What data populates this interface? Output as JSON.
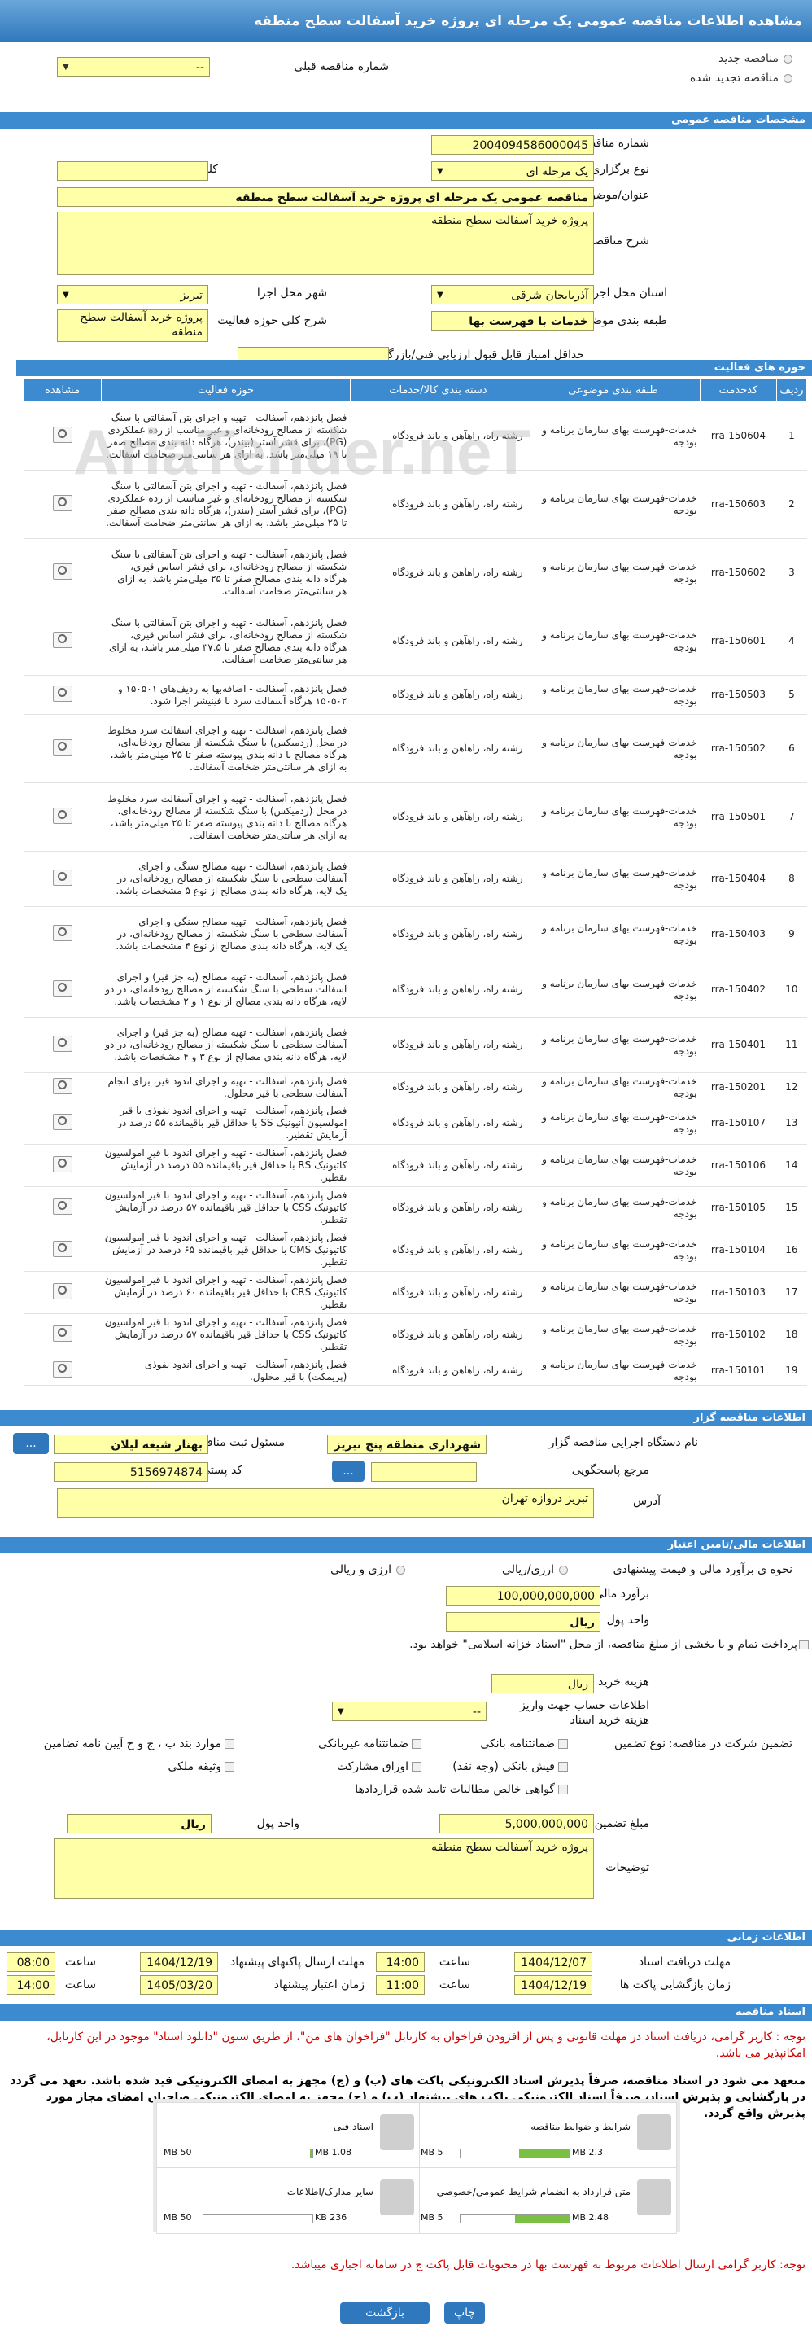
{
  "title": "مشاهده اطلاعات مناقصه عمومی یک مرحله ای پروژه خرید آسفالت سطح منطقه",
  "radios": {
    "new": "مناقصه جدید",
    "renewed": "مناقصه تجدید شده",
    "prev_label": "شماره مناقصه قبلی",
    "prev_value": "--"
  },
  "sections": {
    "specs": "مشخصات مناقصه عمومی",
    "activities": "حوزه های فعالیت",
    "organizer": "اطلاعات مناقصه گزار",
    "financial": "اطلاعات مالی/تامین اعتبار",
    "timing": "اطلاعات زمانی",
    "docs": "اسناد مناقصه"
  },
  "specs": {
    "number_label": "شماره مناقصه",
    "number": "2004094586000045",
    "type_label": "نوع برگزاری",
    "type": "یک مرحله ای",
    "keyword_label": "کلید واژه",
    "keyword": "",
    "subject_label": "عنوان/موضوع مناقصه",
    "subject": "مناقصه عمومی یک مرحله ای پروژه خرید آسفالت سطح منطقه",
    "desc_label": "شرح مناقصه",
    "desc": "پروژه خرید آسفالت سطح منطقه",
    "province_label": "استان محل اجرا",
    "province": "آذربایجان شرقی",
    "city_label": "شهر محل اجرا",
    "city": "تبریز",
    "category_label": "طبقه بندی موضوعی",
    "category": "خدمات با فهرست بها",
    "scope_label": "شرح کلی حوزه فعالیت",
    "scope": "پروژه خرید آسفالت سطح منطقه",
    "min_score_label": "حداقل امتیاز قابل قبول ارزیابی فنی/بازرگانی",
    "min_score": ""
  },
  "activity_table": {
    "headers": [
      "ردیف",
      "کدخدمت",
      "طبقه بندی موضوعی",
      "دسته بندی کالا/خدمات",
      "حوزه فعالیت",
      "مشاهده"
    ],
    "rows": [
      {
        "idx": "1",
        "code": "rra-150604",
        "cls": "خدمات-فهرست بهای سازمان برنامه و بودجه",
        "cat": "رشته راه، راهآهن و باند فرودگاه",
        "scope": "فصل پانزدهم، آسفالت - تهیه و اجرای بتن آسفالتی با سنگ شکسته از مصالح رودخانه‌ای و غیر مناسب از رده عملکردی (PG)، برای قشر آستر (بیندر)، هرگاه دانه بندی مصالح صفر تا ۱۹ میلی‌متر باشد، به ازای هر سانتی‌متر ضخامت آسفالت."
      },
      {
        "idx": "2",
        "code": "rra-150603",
        "cls": "خدمات-فهرست بهای سازمان برنامه و بودجه",
        "cat": "رشته راه، راهآهن و باند فرودگاه",
        "scope": "فصل پانزدهم، آسفالت - تهیه و اجرای بتن آسفالتی با سنگ شکسته از مصالح رودخانه‌ای و غیر مناسب از رده عملکردی (PG)، برای قشر آستر (بیندر)، هرگاه دانه بندی مصالح صفر تا ۲۵ میلی‌متر باشد، به ازای هر سانتی‌متر ضخامت آسفالت."
      },
      {
        "idx": "3",
        "code": "rra-150602",
        "cls": "خدمات-فهرست بهای سازمان برنامه و بودجه",
        "cat": "رشته راه، راهآهن و باند فرودگاه",
        "scope": "فصل پانزدهم، آسفالت - تهیه و اجرای بتن آسفالتی با سنگ شکسته از مصالح رودخانه‌ای، برای قشر اساس قیری، هرگاه دانه بندی مصالح صفر تا ۲۵ میلی‌متر باشد، به ازای هر سانتی‌متر ضخامت آسفالت."
      },
      {
        "idx": "4",
        "code": "rra-150601",
        "cls": "خدمات-فهرست بهای سازمان برنامه و بودجه",
        "cat": "رشته راه، راهآهن و باند فرودگاه",
        "scope": "فصل پانزدهم، آسفالت - تهیه و اجرای بتن آسفالتی با سنگ شکسته از مصالح رودخانه‌ای، برای قشر اساس قیری، هرگاه دانه بندی مصالح صفر تا ۳۷.۵ میلی‌متر باشد، به ازای هر سانتی‌متر ضخامت آسفالت."
      },
      {
        "idx": "5",
        "code": "rra-150503",
        "cls": "خدمات-فهرست بهای سازمان برنامه و بودجه",
        "cat": "رشته راه، راهآهن و باند فرودگاه",
        "scope": "فصل پانزدهم، آسفالت - اضافه‌بها به ردیف‌های ۱۵۰۵۰۱ و ۱۵۰۵۰۲ هرگاه آسفالت سرد با فینیشر اجرا شود."
      },
      {
        "idx": "6",
        "code": "rra-150502",
        "cls": "خدمات-فهرست بهای سازمان برنامه و بودجه",
        "cat": "رشته راه، راهآهن و باند فرودگاه",
        "scope": "فصل پانزدهم، آسفالت - تهیه و اجرای آسفالت سرد مخلوط در محل (ردمیکس) با سنگ شکسته از مصالح رودخانه‌ای، هرگاه مصالح با دانه بندی پیوسته صفر تا ۲۵ میلی‌متر باشد، به ازای هر سانتی‌متر ضخامت آسفالت."
      },
      {
        "idx": "7",
        "code": "rra-150501",
        "cls": "خدمات-فهرست بهای سازمان برنامه و بودجه",
        "cat": "رشته راه، راهآهن و باند فرودگاه",
        "scope": "فصل پانزدهم، آسفالت - تهیه و اجرای آسفالت سرد مخلوط در محل (ردمیکس) با سنگ شکسته از مصالح رودخانه‌ای، هرگاه مصالح با دانه بندی پیوسته صفر تا ۲۵ میلی‌متر باشد، به ازای هر سانتی‌متر ضخامت آسفالت."
      },
      {
        "idx": "8",
        "code": "rra-150404",
        "cls": "خدمات-فهرست بهای سازمان برنامه و بودجه",
        "cat": "رشته راه، راهآهن و باند فرودگاه",
        "scope": "فصل پانزدهم، آسفالت - تهیه مصالح سنگی و اجرای آسفالت سطحی با سنگ شکسته از مصالح رودخانه‌ای، در یک لایه، هرگاه دانه بندی مصالح از نوع ۵ مشخصات باشد."
      },
      {
        "idx": "9",
        "code": "rra-150403",
        "cls": "خدمات-فهرست بهای سازمان برنامه و بودجه",
        "cat": "رشته راه، راهآهن و باند فرودگاه",
        "scope": "فصل پانزدهم، آسفالت - تهیه مصالح سنگی و اجرای آسفالت سطحی با سنگ شکسته از مصالح رودخانه‌ای، در یک لایه، هرگاه دانه بندی مصالح از نوع ۴ مشخصات باشد."
      },
      {
        "idx": "10",
        "code": "rra-150402",
        "cls": "خدمات-فهرست بهای سازمان برنامه و بودجه",
        "cat": "رشته راه، راهآهن و باند فرودگاه",
        "scope": "فصل پانزدهم، آسفالت - تهیه مصالح (به جز قیر) و اجرای آسفالت سطحی با سنگ شکسته از مصالح رودخانه‌ای، در دو لایه، هرگاه دانه بندی مصالح از نوع ۱ و ۲ مشخصات باشد."
      },
      {
        "idx": "11",
        "code": "rra-150401",
        "cls": "خدمات-فهرست بهای سازمان برنامه و بودجه",
        "cat": "رشته راه، راهآهن و باند فرودگاه",
        "scope": "فصل پانزدهم، آسفالت - تهیه مصالح (به جز قیر) و اجرای آسفالت سطحی با سنگ شکسته از مصالح رودخانه‌ای، در دو لایه، هرگاه دانه بندی مصالح از نوع ۳ و ۴ مشخصات باشد."
      },
      {
        "idx": "12",
        "code": "rra-150201",
        "cls": "خدمات-فهرست بهای سازمان برنامه و بودجه",
        "cat": "رشته راه، راهآهن و باند فرودگاه",
        "scope": "فصل پانزدهم، آسفالت - تهیه و اجرای اندود قیر، برای انجام آسفالت سطحی با قیر محلول."
      },
      {
        "idx": "13",
        "code": "rra-150107",
        "cls": "خدمات-فهرست بهای سازمان برنامه و بودجه",
        "cat": "رشته راه، راهآهن و باند فرودگاه",
        "scope": "فصل پانزدهم، آسفالت - تهیه و اجرای اندود نفوذی با قیر امولسیون آنیونیک SS با حداقل قیر باقیمانده ۵۵ درصد در آزمایش تقطیر."
      },
      {
        "idx": "14",
        "code": "rra-150106",
        "cls": "خدمات-فهرست بهای سازمان برنامه و بودجه",
        "cat": "رشته راه، راهآهن و باند فرودگاه",
        "scope": "فصل پانزدهم، آسفالت - تهیه و اجرای اندود با قیر امولسیون کاتیونیک RS با حداقل قیر باقیمانده ۵۵ درصد در آزمایش تقطیر."
      },
      {
        "idx": "15",
        "code": "rra-150105",
        "cls": "خدمات-فهرست بهای سازمان برنامه و بودجه",
        "cat": "رشته راه، راهآهن و باند فرودگاه",
        "scope": "فصل پانزدهم، آسفالت - تهیه و اجرای اندود با قیر امولسیون کاتیونیک CSS با حداقل قیر باقیمانده ۵۷ درصد در آزمایش تقطیر."
      },
      {
        "idx": "16",
        "code": "rra-150104",
        "cls": "خدمات-فهرست بهای سازمان برنامه و بودجه",
        "cat": "رشته راه، راهآهن و باند فرودگاه",
        "scope": "فصل پانزدهم، آسفالت - تهیه و اجرای اندود با قیر امولسیون کاتیونیک CMS با حداقل قیر باقیمانده ۶۵ درصد در آزمایش تقطیر."
      },
      {
        "idx": "17",
        "code": "rra-150103",
        "cls": "خدمات-فهرست بهای سازمان برنامه و بودجه",
        "cat": "رشته راه، راهآهن و باند فرودگاه",
        "scope": "فصل پانزدهم، آسفالت - تهیه و اجرای اندود با قیر امولسیون کاتیونیک CRS با حداقل قیر باقیمانده ۶۰ درصد در آزمایش تقطیر."
      },
      {
        "idx": "18",
        "code": "rra-150102",
        "cls": "خدمات-فهرست بهای سازمان برنامه و بودجه",
        "cat": "رشته راه، راهآهن و باند فرودگاه",
        "scope": "فصل پانزدهم، آسفالت - تهیه و اجرای اندود با قیر امولسیون کاتیونیک CSS با حداقل قیر باقیمانده ۵۷ درصد در آزمایش تقطیر."
      },
      {
        "idx": "19",
        "code": "rra-150101",
        "cls": "خدمات-فهرست بهای سازمان برنامه و بودجه",
        "cat": "رشته راه، راهآهن و باند فرودگاه",
        "scope": "فصل پانزدهم، آسفالت - تهیه و اجرای اندود نفوذی (پریمکت) با قیر محلول."
      }
    ]
  },
  "organizer": {
    "org_label": "نام دستگاه اجرایی مناقصه گزار",
    "org": "شهرداری منطقه پنج تبریز",
    "person_label": "مسئول ثبت مناقصه",
    "person": "بهنار شیعه لیلان",
    "ref_label": "مرجع پاسخگویی",
    "ref": "",
    "postal_label": "کد پستی",
    "postal": "5156974874",
    "address_label": "آدرس",
    "address": "تبریز دروازه تهران",
    "more_btn": "..."
  },
  "financial": {
    "estimate_type_label": "نحوه ی برآورد مالی و قیمت پیشنهادی",
    "opt_rial": "ارزی/ریالی",
    "opt_fx": "ارزی و ریالی",
    "estimate_label": "برآورد مالی",
    "estimate": "100,000,000,000",
    "currency_label": "واحد پول",
    "currency": "ریال",
    "full_payment_label": "پرداخت تمام و یا بخشی از مبلغ مناقصه، از محل \"اسناد خزانه اسلامی\" خواهد بود.",
    "doc_cost_label": "هزینه خرید اسناد",
    "doc_cost_unit": "ریال",
    "account_label": "اطلاعات حساب جهت واریز هزینه خرید اسناد",
    "account": "--",
    "guarantee_label": "تضمین شرکت در مناقصه:",
    "guarantee_type_label": "نوع تضمین",
    "g1": "ضمانتنامه بانکی",
    "g2": "ضمانتنامه غیربانکی",
    "g3": "موارد بند ب ، ج و خ آیین نامه تضامین",
    "g4": "فیش بانکی (وجه نقد)",
    "g5": "اوراق مشارکت",
    "g6": "وثیقه ملکی",
    "g7": "گواهی خالص مطالبات تایید شده قراردادها",
    "amount_label": "مبلغ تضمین",
    "amount": "5,000,000,000",
    "amount_currency": "ریال",
    "notes_label": "توضیحات",
    "notes": "پروژه خرید آسفالت سطح منطقه"
  },
  "timing": {
    "receive_deadline_label": "مهلت دریافت اسناد",
    "receive_date": "1404/12/07",
    "receive_time": "14:00",
    "send_deadline_label": "مهلت ارسال پاکتهای پیشنهاد",
    "send_date": "1404/12/19",
    "send_time": "08:00",
    "open_label": "زمان بازگشایی پاکت ها",
    "open_date": "1404/12/19",
    "open_time": "11:00",
    "validity_label": "زمان اعتبار پیشنهاد",
    "validity_date": "1405/03/20",
    "validity_time": "14:00",
    "time_label": "ساعت"
  },
  "notes": {
    "note1": "توجه : کاربر گرامی، دریافت اسناد در مهلت قانونی و پس از افزودن فراخوان به کارتابل \"فراخوان های من\"، از طریق ستون \"دانلود اسناد\" موجود در این کارتابل، امکانپذیر می باشد.",
    "note2": "متعهد می شود در اسناد مناقصه، صرفاً پذیرش اسناد الکترونیکی پاکت های (ب) و (ج) مجهز به امضای الکترونیکی قید شده باشد. تعهد می گردد در بارگشایی و پذیرش اسناد، صرفاً اسناد الکترونیکی پاکت های پیشنهاد (ب) و (ج) مجهز به امضای الکترونیکی صاحبان امضای مجاز مورد پذیرش واقع گردد.",
    "note3": "توجه: کاربر گرامی ارسال اطلاعات مربوط به فهرست بها در محتویات قابل پاکت ج در سامانه اجباری میباشد."
  },
  "documents": [
    {
      "name": "شرایط و ضوابط مناقصه",
      "size": "2.3 MB",
      "max": "5 MB",
      "fill": 0.46
    },
    {
      "name": "اسناد فنی",
      "size": "1.08 MB",
      "max": "50 MB",
      "fill": 0.02
    },
    {
      "name": "متن قرارداد به انضمام شرایط عمومی/خصوصی",
      "size": "2.48 MB",
      "max": "5 MB",
      "fill": 0.5
    },
    {
      "name": "سایر مدارک/اطلاعات",
      "size": "236 KB",
      "max": "50 MB",
      "fill": 0.01
    }
  ],
  "buttons": {
    "print": "چاپ",
    "back": "بازگشت"
  },
  "watermark": "AriaTender.neT"
}
